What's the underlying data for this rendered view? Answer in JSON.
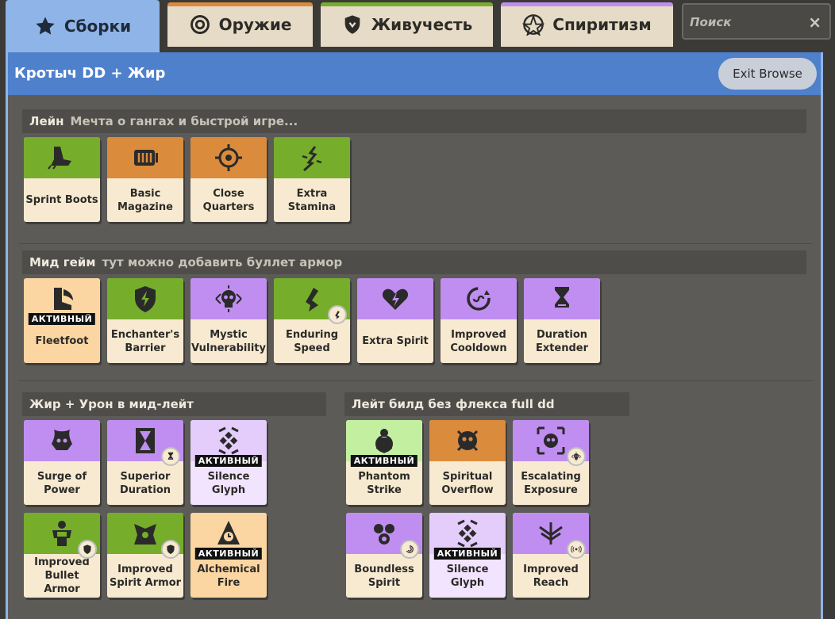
{
  "tabs": [
    {
      "label": "Сборки",
      "icon": "star-icon"
    },
    {
      "label": "Оружие",
      "icon": "target-icon",
      "color": "#da8b3c"
    },
    {
      "label": "Живучесть",
      "icon": "shield-icon",
      "color": "#76ad2b"
    },
    {
      "label": "Спиритизм",
      "icon": "pentagram-icon",
      "color": "#c08ef0"
    }
  ],
  "search": {
    "placeholder": "Поиск",
    "close": "×"
  },
  "build": {
    "title": "Кротыч DD + Жир",
    "exit_label": "Exit Browse"
  },
  "badge_text": "АКТИВНЫЙ",
  "sections": {
    "lane": {
      "name": "Лейн",
      "desc": "Мечта о гангах и быстрой игре...",
      "items": [
        {
          "label": "Sprint Boots",
          "color": "green",
          "icon": "boots-icon"
        },
        {
          "label": "Basic Magazine",
          "color": "orange",
          "icon": "magazine-icon"
        },
        {
          "label": "Close Quarters",
          "color": "orange",
          "icon": "crosshair-icon"
        },
        {
          "label": "Extra Stamina",
          "color": "green",
          "icon": "stamina-icon"
        }
      ]
    },
    "mid": {
      "name": "Мид гейм",
      "desc": "тут можно добавить буллет армор",
      "items": [
        {
          "label": "Fleetfoot",
          "color": "active-orange",
          "icon": "winged-boot-icon",
          "active": true
        },
        {
          "label": "Enchanter's Barrier",
          "color": "green",
          "icon": "shield-bolt-icon"
        },
        {
          "label": "Mystic Vulnerability",
          "color": "purple",
          "icon": "skull-icon"
        },
        {
          "label": "Enduring Speed",
          "color": "green",
          "icon": "runner-icon",
          "mini": "run-icon"
        },
        {
          "label": "Extra Spirit",
          "color": "purple",
          "icon": "heart-bolt-icon"
        },
        {
          "label": "Improved Cooldown",
          "color": "purple",
          "icon": "cooldown-icon"
        },
        {
          "label": "Duration Extender",
          "color": "purple",
          "icon": "hourglass-icon"
        }
      ]
    },
    "fat": {
      "name": "Жир + Урон в мид-лейт",
      "desc": "",
      "items": [
        {
          "label": "Surge of Power",
          "color": "purple",
          "icon": "power-skull-icon"
        },
        {
          "label": "Superior Duration",
          "color": "purple",
          "icon": "duration-icon",
          "mini": "hourglass-icon"
        },
        {
          "label": "Silence Glyph",
          "color": "active-purple",
          "icon": "glyph-icon",
          "active": true
        },
        {
          "label": "Improved Bullet Armor",
          "color": "green",
          "icon": "armor-man-icon",
          "mini": "shield-icon"
        },
        {
          "label": "Improved Spirit Armor",
          "color": "green",
          "icon": "spirit-armor-icon",
          "mini": "shield-icon"
        },
        {
          "label": "Alchemical Fire",
          "color": "active-orange",
          "icon": "alchemy-icon",
          "active": true
        }
      ]
    },
    "late": {
      "name": "Лейт билд без флекса full dd",
      "desc": "",
      "items": [
        {
          "label": "Phantom Strike",
          "color": "active-green",
          "icon": "phantom-icon",
          "active": true
        },
        {
          "label": "Spiritual Overflow",
          "color": "orange",
          "icon": "overflow-icon"
        },
        {
          "label": "Escalating Exposure",
          "color": "purple",
          "icon": "exposure-icon",
          "mini": "skull-icon"
        },
        {
          "label": "Boundless Spirit",
          "color": "purple",
          "icon": "boundless-icon",
          "mini": "swirl-icon"
        },
        {
          "label": "Silence Glyph",
          "color": "active-purple",
          "icon": "glyph-icon",
          "active": true
        },
        {
          "label": "Improved Reach",
          "color": "purple",
          "icon": "reach-icon",
          "mini": "signal-icon"
        }
      ]
    }
  }
}
